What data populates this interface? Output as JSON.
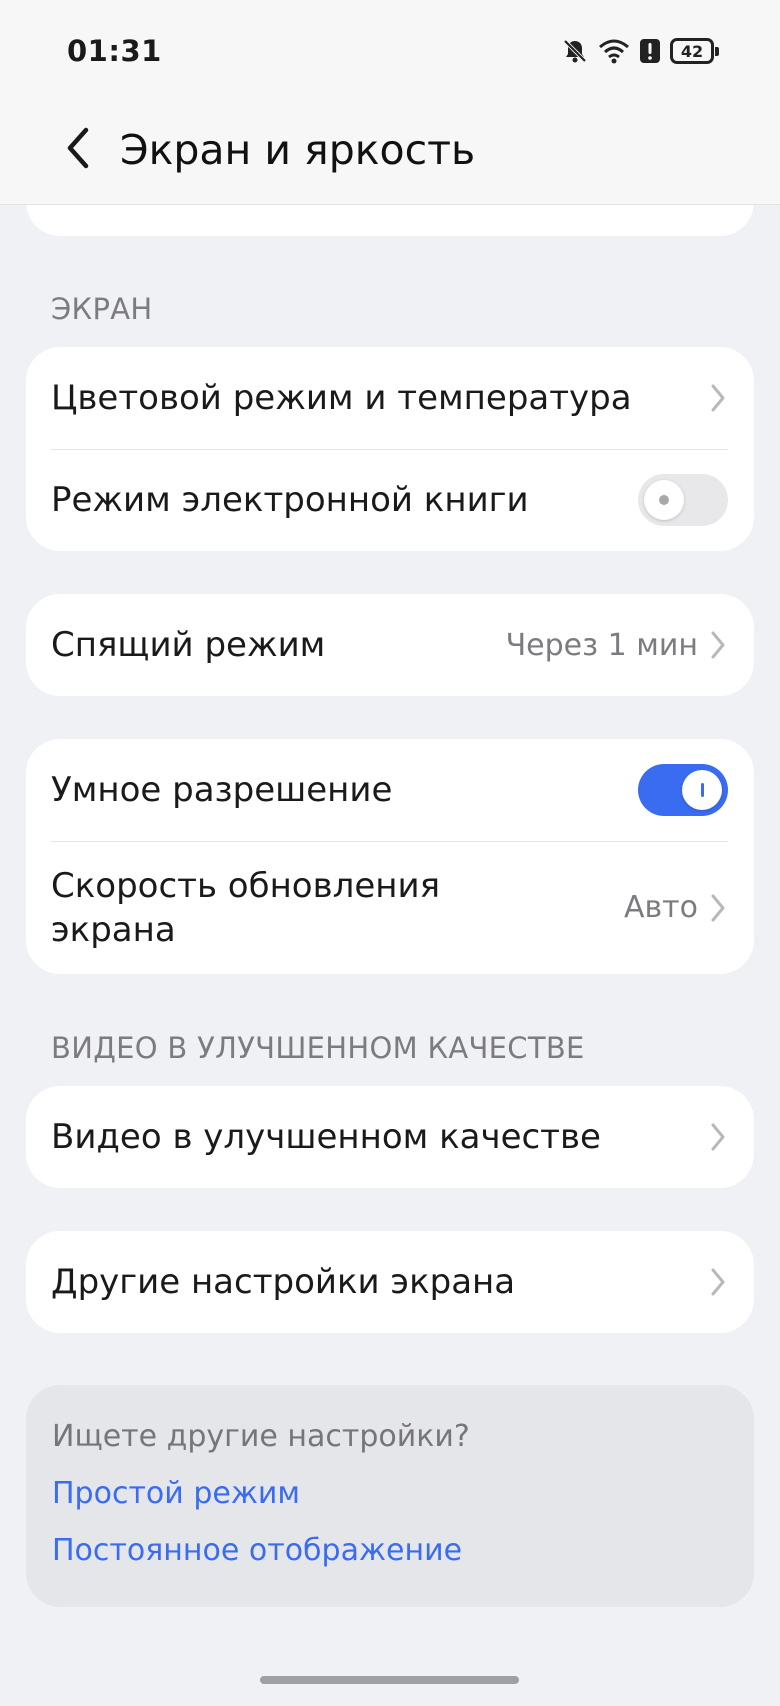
{
  "status_bar": {
    "time": "01:31",
    "battery": "42",
    "icons": [
      "bell-off-icon",
      "wifi-icon",
      "alert-icon",
      "battery-icon"
    ]
  },
  "header": {
    "title": "Экран и яркость",
    "back_icon": "chevron-left-icon"
  },
  "sections": {
    "screen_title": "ЭКРАН",
    "video_title": "ВИДЕО В УЛУЧШЕННОМ КАЧЕСТВЕ"
  },
  "items": {
    "color_mode": "Цветовой режим и температура",
    "ebook_mode": "Режим электронной книги",
    "ebook_mode_enabled": false,
    "sleep": "Спящий режим",
    "sleep_value": "Через 1 мин",
    "smart_resolution": "Умное разрешение",
    "smart_resolution_enabled": true,
    "refresh_rate_line1": "Скорость обновления",
    "refresh_rate_line2": "экрана",
    "refresh_rate_value": "Авто",
    "enhanced_video": "Видео в улучшенном качестве",
    "other_settings": "Другие настройки экрана"
  },
  "suggestions": {
    "title": "Ищете другие настройки?",
    "links": [
      "Простой режим",
      "Постоянное отображение"
    ]
  },
  "colors": {
    "accent": "#3a6cf2",
    "background": "#f0f1f5",
    "card": "#ffffff"
  }
}
